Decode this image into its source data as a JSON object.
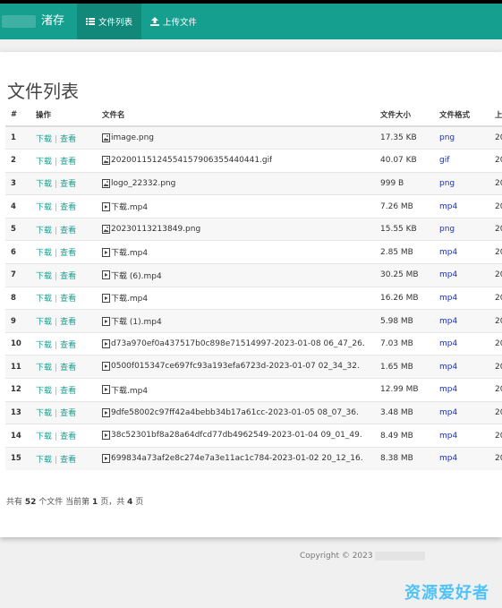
{
  "navbar": {
    "brand": "渚存",
    "items": [
      {
        "label": "文件列表",
        "icon": "list-icon",
        "active": true
      },
      {
        "label": "上传文件",
        "icon": "upload-icon",
        "active": false
      }
    ]
  },
  "page_title": "文件列表",
  "table": {
    "headers": [
      "#",
      "操作",
      "文件名",
      "文件大小",
      "文件格式",
      "上"
    ],
    "download_label": "下载",
    "view_label": "查看",
    "rows": [
      {
        "num": "1",
        "name": "image.png",
        "icon": "image-file-icon",
        "size": "17.35 KB",
        "format": "png",
        "date": "20"
      },
      {
        "num": "2",
        "name": "20200115124554157906355440441.gif",
        "icon": "image-file-icon",
        "size": "40.07 KB",
        "format": "gif",
        "date": "20"
      },
      {
        "num": "3",
        "name": "logo_22332.png",
        "icon": "image-file-icon",
        "size": "999 B",
        "format": "png",
        "date": "20"
      },
      {
        "num": "4",
        "name": "下载.mp4",
        "icon": "video-file-icon",
        "size": "7.26 MB",
        "format": "mp4",
        "date": "20"
      },
      {
        "num": "5",
        "name": "20230113213849.png",
        "icon": "image-file-icon",
        "size": "15.55 KB",
        "format": "png",
        "date": "20"
      },
      {
        "num": "6",
        "name": "下载.mp4",
        "icon": "video-file-icon",
        "size": "2.85 MB",
        "format": "mp4",
        "date": "20"
      },
      {
        "num": "7",
        "name": "下载 (6).mp4",
        "icon": "video-file-icon",
        "size": "30.25 MB",
        "format": "mp4",
        "date": "20"
      },
      {
        "num": "8",
        "name": "下载.mp4",
        "icon": "video-file-icon",
        "size": "16.26 MB",
        "format": "mp4",
        "date": "20"
      },
      {
        "num": "9",
        "name": "下载 (1).mp4",
        "icon": "video-file-icon",
        "size": "5.98 MB",
        "format": "mp4",
        "date": "20"
      },
      {
        "num": "10",
        "name": "d73a970ef0a437517b0c898e71514997-2023-01-08 06_47_26.",
        "icon": "video-file-icon",
        "size": "7.03 MB",
        "format": "mp4",
        "date": "20"
      },
      {
        "num": "11",
        "name": "0500f015347ce697fc93a193efa6723d-2023-01-07 02_34_32.",
        "icon": "video-file-icon",
        "size": "1.65 MB",
        "format": "mp4",
        "date": "20"
      },
      {
        "num": "12",
        "name": "下载.mp4",
        "icon": "video-file-icon",
        "size": "12.99 MB",
        "format": "mp4",
        "date": "20"
      },
      {
        "num": "13",
        "name": "9dfe58002c97ff42a4bebb34b17a61cc-2023-01-05 08_07_36.",
        "icon": "video-file-icon",
        "size": "3.48 MB",
        "format": "mp4",
        "date": "20"
      },
      {
        "num": "14",
        "name": "38c52301bf8a28a64dfcd77db4962549-2023-01-04 09_01_49.",
        "icon": "video-file-icon",
        "size": "8.49 MB",
        "format": "mp4",
        "date": "20"
      },
      {
        "num": "15",
        "name": "699834a73af2e8c274e7a3e11ac1c784-2023-01-02 20_12_16.",
        "icon": "video-file-icon",
        "size": "8.38 MB",
        "format": "mp4",
        "date": "20"
      }
    ]
  },
  "pager": {
    "prefix": "共有",
    "total": "52",
    "total_suffix": "个文件  当前第",
    "current": "1",
    "current_suffix": "页，共",
    "pages": "4",
    "pages_suffix": "页"
  },
  "footer": {
    "copyright": "Copyright © 2023"
  },
  "watermark": "资源爱好者",
  "colors": {
    "accent": "#159f8f",
    "format_link": "#1a2fbf",
    "watermark": "#4fc3f7"
  }
}
